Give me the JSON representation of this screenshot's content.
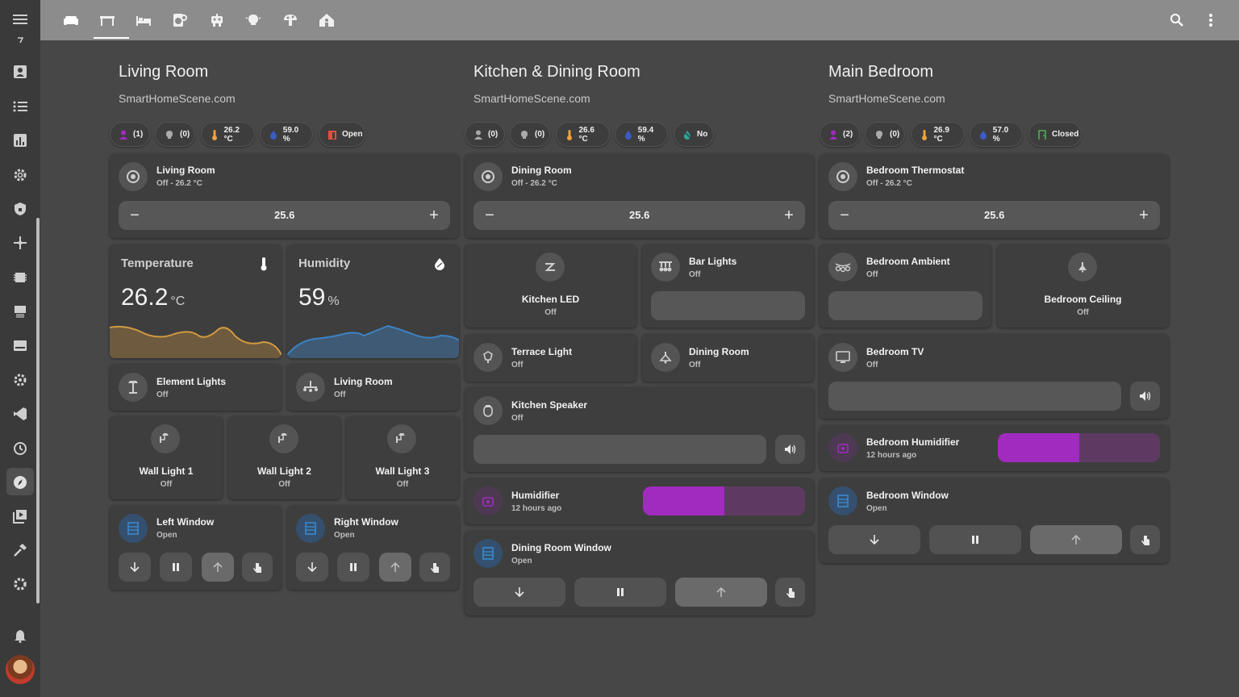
{
  "topbar": {
    "tabs": [
      {
        "icon": "sofa-icon"
      },
      {
        "icon": "table-icon"
      },
      {
        "icon": "bed-icon"
      },
      {
        "icon": "washer-icon"
      },
      {
        "icon": "robot-icon"
      },
      {
        "icon": "lightbulb-icon"
      },
      {
        "icon": "mushroom-icon"
      },
      {
        "icon": "home-person-icon"
      }
    ],
    "search_icon": "search-icon",
    "menu_icon": "dots-vertical-icon"
  },
  "sidebar": {
    "items": [
      "menu-icon",
      "chevron-icon",
      "account-box-icon",
      "format-list-icon",
      "chart-icon",
      "cog-outline-icon",
      "shield-home-icon",
      "network-icon",
      "chip-icon",
      "hacs-icon",
      "monitor-icon",
      "cog-play-icon",
      "vscode-icon",
      "history-icon",
      "compass-icon",
      "media-icon",
      "hammer-icon",
      "settings-icon",
      "bell-icon"
    ]
  },
  "colors": {
    "accent_purple": "#a12bbf",
    "accent_blue": "#3b82c4",
    "accent_orange": "#f0a23b",
    "sensor_temp": "#b08040",
    "sensor_hum": "#3b78b5"
  },
  "living": {
    "title": "Living Room",
    "subtitle": "SmartHomeScene.com",
    "chips": [
      "(1)",
      "(0)",
      "26.2 °C",
      "59.0 %",
      "Open"
    ],
    "thermostat": {
      "name": "Living Room",
      "state": "Off - 26.2 °C",
      "target": "25.6",
      "minus": "−",
      "plus": "+"
    },
    "temperature": {
      "label": "Temperature",
      "value": "26.2",
      "unit": "°C"
    },
    "humidity": {
      "label": "Humidity",
      "value": "59",
      "unit": "%"
    },
    "element_lights": {
      "name": "Element Lights",
      "state": "Off"
    },
    "living_light": {
      "name": "Living Room",
      "state": "Off"
    },
    "wall_lights": [
      {
        "name": "Wall Light 1",
        "state": "Off"
      },
      {
        "name": "Wall Light 2",
        "state": "Off"
      },
      {
        "name": "Wall Light 3",
        "state": "Off"
      }
    ],
    "left_window": {
      "name": "Left Window",
      "state": "Open"
    },
    "right_window": {
      "name": "Right Window",
      "state": "Open"
    }
  },
  "kitchen": {
    "title": "Kitchen & Dining Room",
    "subtitle": "SmartHomeScene.com",
    "chips": [
      "(0)",
      "(0)",
      "26.6 °C",
      "59.4 %",
      "No"
    ],
    "thermostat": {
      "name": "Dining Room",
      "state": "Off - 26.2 °C",
      "target": "25.6",
      "minus": "−",
      "plus": "+"
    },
    "kitchen_led": {
      "name": "Kitchen LED",
      "state": "Off"
    },
    "bar_lights": {
      "name": "Bar Lights",
      "state": "Off"
    },
    "terrace": {
      "name": "Terrace Light",
      "state": "Off"
    },
    "dining_light": {
      "name": "Dining Room",
      "state": "Off"
    },
    "speaker": {
      "name": "Kitchen Speaker",
      "state": "Off"
    },
    "humidifier": {
      "name": "Humidifier",
      "state": "12 hours ago",
      "level": 0.5
    },
    "window": {
      "name": "Dining Room Window",
      "state": "Open"
    }
  },
  "bedroom": {
    "title": "Main Bedroom",
    "subtitle": "SmartHomeScene.com",
    "chips": [
      "(2)",
      "(0)",
      "26.9 °C",
      "57.0 %",
      "Closed"
    ],
    "thermostat": {
      "name": "Bedroom Thermostat",
      "state": "Off - 26.2 °C",
      "target": "25.6",
      "minus": "−",
      "plus": "+"
    },
    "ambient": {
      "name": "Bedroom Ambient",
      "state": "Off"
    },
    "ceiling": {
      "name": "Bedroom Ceiling",
      "state": "Off"
    },
    "tv": {
      "name": "Bedroom TV",
      "state": "Off"
    },
    "humidifier": {
      "name": "Bedroom Humidifier",
      "state": "12 hours ago",
      "level": 0.5
    },
    "window": {
      "name": "Bedroom Window",
      "state": "Open"
    }
  }
}
